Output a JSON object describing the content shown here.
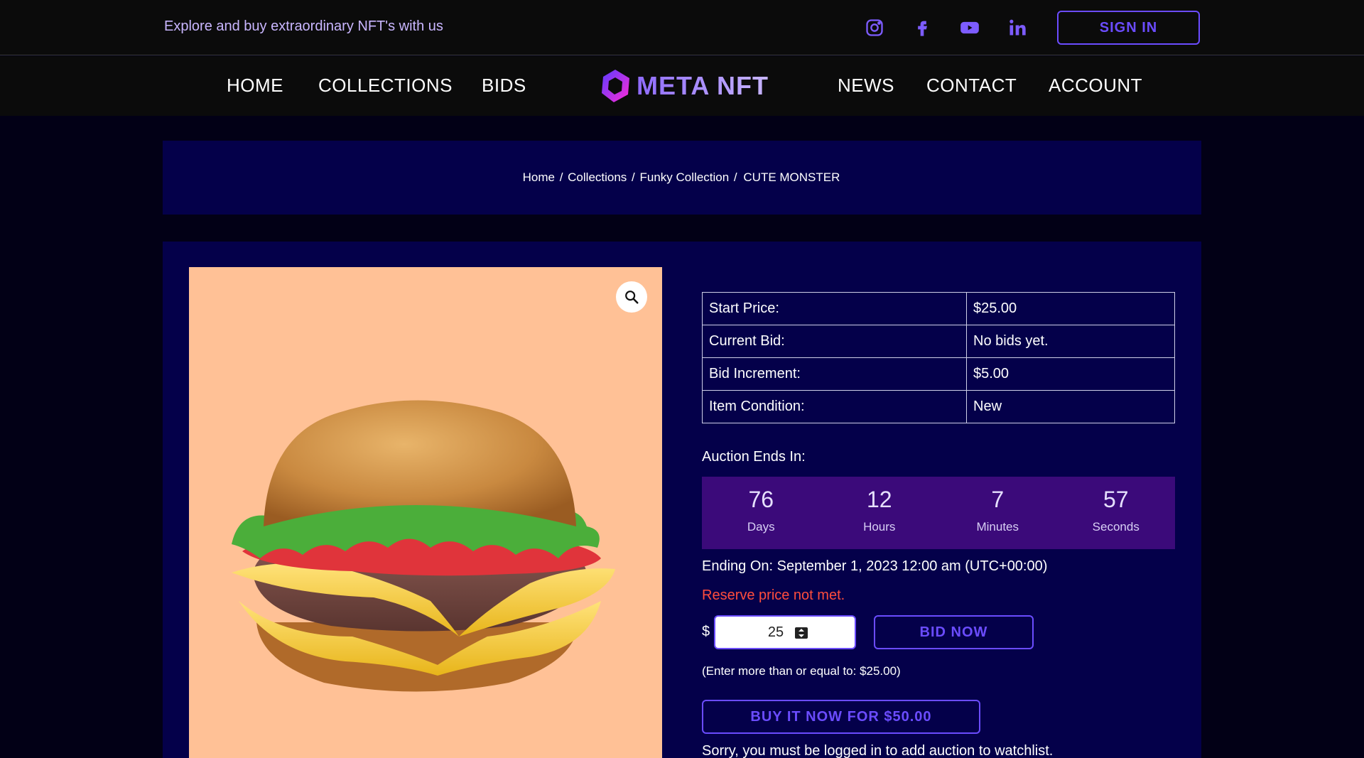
{
  "topbar": {
    "tagline": "Explore and buy extraordinary NFT's with us",
    "social": [
      "instagram-icon",
      "facebook-icon",
      "youtube-icon",
      "linkedin-icon"
    ],
    "signin_label": "SIGN IN"
  },
  "nav": {
    "left": [
      "HOME",
      "COLLECTIONS",
      "BIDS"
    ],
    "logo_text": "META NFT",
    "right": [
      "NEWS",
      "CONTACT",
      "ACCOUNT"
    ]
  },
  "breadcrumb": {
    "items": [
      "Home",
      "Collections",
      "Funky Collection",
      "CUTE MONSTER"
    ],
    "separator": "/"
  },
  "product": {
    "image_alt_icon": "burger-image",
    "zoom_icon": "magnifier-icon"
  },
  "info": {
    "rows": [
      {
        "label": "Start Price:",
        "value": "$25.00"
      },
      {
        "label": "Current Bid:",
        "value": "No bids yet."
      },
      {
        "label": "Bid Increment:",
        "value": "$5.00"
      },
      {
        "label": "Item Condition:",
        "value": "New"
      }
    ]
  },
  "auction": {
    "label": "Auction Ends In:",
    "countdown": [
      {
        "value": "76",
        "unit": "Days"
      },
      {
        "value": "12",
        "unit": "Hours"
      },
      {
        "value": "7",
        "unit": "Minutes"
      },
      {
        "value": "57",
        "unit": "Seconds"
      }
    ],
    "ending_on": "Ending On: September 1, 2023 12:00 am (UTC+00:00)",
    "reserve_text": "Reserve price not met."
  },
  "bid": {
    "currency": "$",
    "amount": "25",
    "bid_label": "BID NOW",
    "hint": "(Enter more than or equal to: $25.00)",
    "buy_label": "BUY IT NOW FOR $50.00",
    "watchlist_msg": "Sorry, you must be logged in to add auction to watchlist."
  },
  "colors": {
    "accent": "#6b4cff",
    "panel": "#04004a",
    "countdown_bg": "#3b0a7a",
    "reserve": "#ff4d3d",
    "image_bg": "#ffc196"
  }
}
